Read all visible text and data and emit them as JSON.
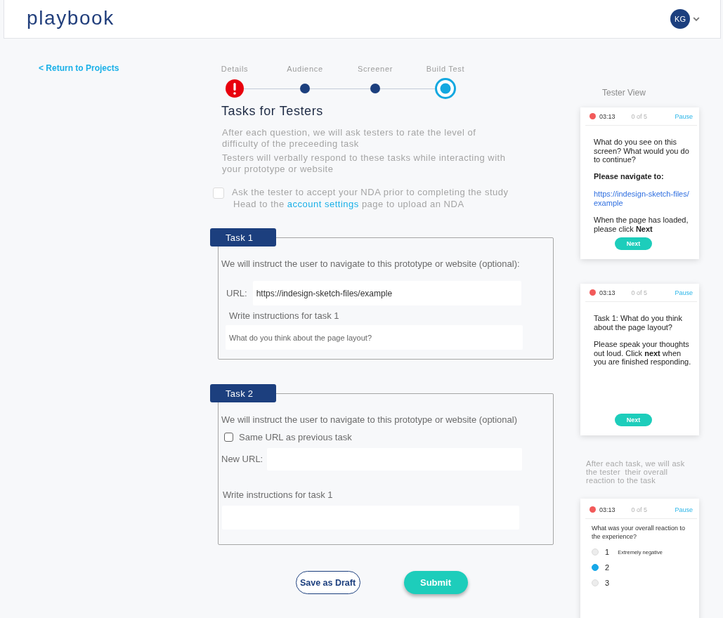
{
  "header": {
    "logo": "playbook",
    "avatar_initials": "KG"
  },
  "back_link": "< Return to Projects",
  "stepper": [
    {
      "label": "Details",
      "kind": "error"
    },
    {
      "label": "Audience",
      "kind": "done"
    },
    {
      "label": "Screener",
      "kind": "done"
    },
    {
      "label": "Build Test",
      "kind": "current"
    }
  ],
  "title": "Tasks for Testers",
  "notes": [
    "After each question, we will ask testers to rate the level of difficulty of the preceeding task",
    "Testers will verbally respond to these tasks while interacting with your prototype or website"
  ],
  "nda": {
    "checked": false,
    "label": "Ask the tester to accept your NDA prior to completing the study",
    "hint_before": "Head to the ",
    "hint_link": "account settings",
    "hint_after": " page to upload an NDA"
  },
  "tasks": [
    {
      "tab": "Task 1",
      "intro": "We will instruct the user to navigate to this prototype or website (optional):",
      "url_label": "URL:",
      "url_value": "https://indesign-sketch-files/example",
      "instructions_label": "Write instructions for task 1",
      "instructions_value": "What do you think about the page layout?"
    },
    {
      "tab": "Task 2",
      "intro": "We will instruct the user to navigate to this prototype or website (optional)",
      "same_url": {
        "label": "Same URL as previous task",
        "checked": false
      },
      "url_label": "New URL:",
      "instructions_label": "Write instructions for task 1"
    }
  ],
  "actions": [
    {
      "kind": "secondary",
      "label": "Save as Draft"
    },
    {
      "kind": "primary",
      "label": "Submit"
    }
  ],
  "tester_view": {
    "title": "Tester View",
    "items": [
      {
        "kind": "navigate",
        "timer": "03:13",
        "progress": "0 of 5",
        "pause": "Pause",
        "question": "What do you see on this screen? What would you do to continue?",
        "prompt": "Please navigate to:",
        "link": "https://indesign-sketch-files/example",
        "instruction": "When the page has loaded, please click **Next**",
        "button": "Next"
      },
      {
        "kind": "task",
        "timer": "03:13",
        "progress": "0 of 5",
        "pause": "Pause",
        "question": "Task 1: What do you think about the page layout?",
        "instruction": "Please speak your thoughts out loud. Click **next** when you are finished responding.",
        "button": "Next"
      },
      {
        "kind": "note",
        "text": "After each task, we will ask the tester  their overall reaction to the task"
      },
      {
        "kind": "rating",
        "timer": "03:13",
        "progress": "0 of 5",
        "pause": "Pause",
        "question": "What was your overall reaction to the experience?",
        "options": [
          {
            "value": "1",
            "label": "Extremely negative",
            "selected": false
          },
          {
            "value": "2",
            "selected": true
          },
          {
            "value": "3",
            "selected": false
          }
        ]
      }
    ]
  }
}
